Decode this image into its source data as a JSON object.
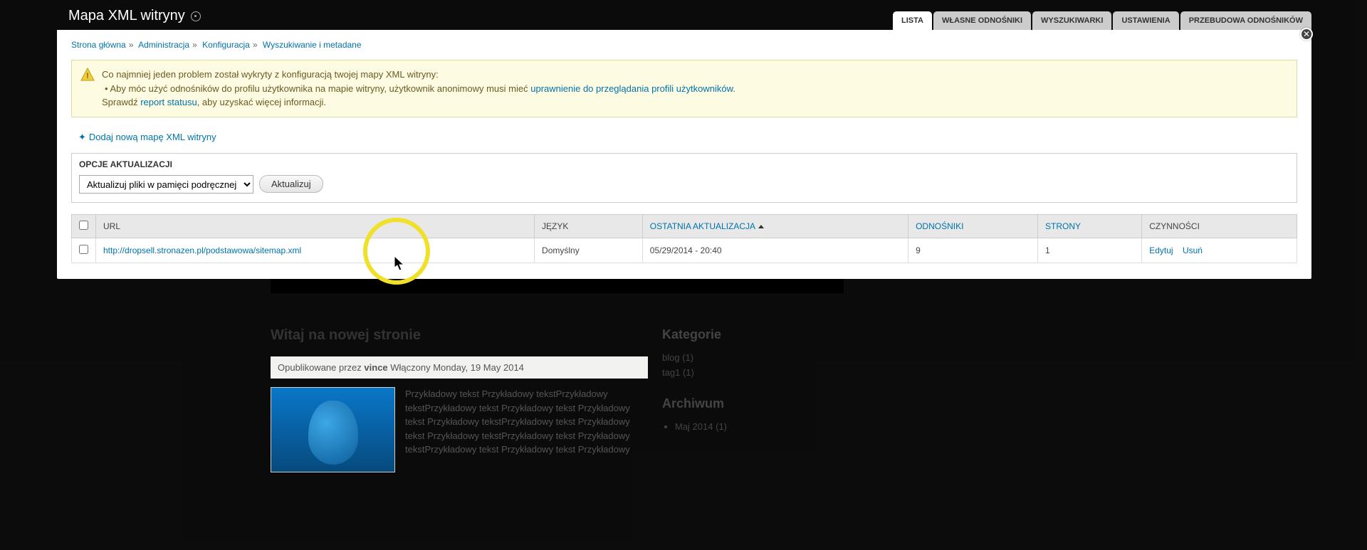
{
  "page_title": "Mapa XML witryny",
  "tabs": [
    {
      "label": "LISTA",
      "active": true
    },
    {
      "label": "WŁASNE ODNOŚNIKI",
      "active": false
    },
    {
      "label": "WYSZUKIWARKI",
      "active": false
    },
    {
      "label": "USTAWIENIA",
      "active": false
    },
    {
      "label": "PRZEBUDOWA ODNOŚNIKÓW",
      "active": false
    }
  ],
  "breadcrumb": [
    "Strona główna",
    "Administracja",
    "Konfiguracja",
    "Wyszukiwanie i metadane"
  ],
  "warning": {
    "intro": "Co najmniej jeden problem został wykryty z konfiguracją twojej mapy XML witryny:",
    "bullet_prefix": "• Aby móc użyć odnośników do profilu użytkownika na mapie witryny, użytkownik anonimowy musi mieć ",
    "bullet_link": "uprawnienie do przeglądania profili użytkowników",
    "check_prefix": "Sprawdź ",
    "check_link": "report statusu",
    "check_suffix": ", aby uzyskać więcej informacji."
  },
  "add_link": "Dodaj nową mapę XML witryny",
  "update_section": {
    "legend": "OPCJE AKTUALIZACJI",
    "select_value": "Aktualizuj pliki w pamięci podręcznej",
    "button": "Aktualizuj"
  },
  "table": {
    "headers": {
      "url": "URL",
      "language": "JĘZYK",
      "last_update": "OSTATNIA AKTUALIZACJA",
      "links": "ODNOŚNIKI",
      "pages": "STRONY",
      "operations": "CZYNNOŚCI"
    },
    "rows": [
      {
        "url": "http://dropsell.stronazen.pl/podstawowa/sitemap.xml",
        "language": "Domyślny",
        "last_update": "05/29/2014 - 20:40",
        "links": "9",
        "pages": "1",
        "op_edit": "Edytuj",
        "op_delete": "Usuń"
      }
    ]
  },
  "background": {
    "article_title": "Witaj na nowej stronie",
    "meta_prefix": "Opublikowane przez ",
    "meta_author": "vince",
    "meta_suffix": " Włączony Monday, 19 May 2014",
    "sample_text": "Przykładowy tekst Przykładowy tekstPrzykładowy tekstPrzykładowy tekst Przykładowy tekst Przykładowy tekst Przykładowy tekstPrzykładowy tekst Przykładowy tekst Przykładowy tekstPrzykładowy tekst Przykładowy tekstPrzykładowy tekst Przykładowy tekst Przykładowy",
    "sidebar": {
      "cat_title": "Kategorie",
      "cat_items": [
        {
          "label": "blog",
          "count": "(1)"
        },
        {
          "label": "tag1",
          "count": "(1)"
        }
      ],
      "archive_title": "Archiwum",
      "archive_items": [
        {
          "label": "Maj 2014",
          "count": "(1)"
        }
      ]
    }
  }
}
